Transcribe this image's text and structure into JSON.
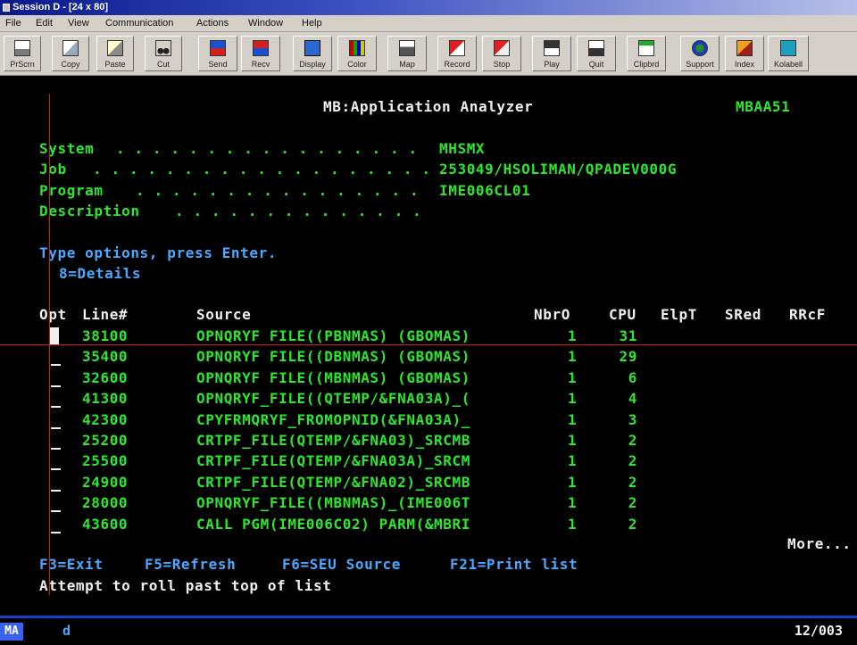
{
  "window": {
    "title": "Session D - [24 x 80]"
  },
  "menu": [
    "File",
    "Edit",
    "View",
    "Communication",
    "Actions",
    "Window",
    "Help"
  ],
  "toolbar": [
    "PrScrn",
    "Copy",
    "Paste",
    "Cut",
    "Send",
    "Recv",
    "Display",
    "Color",
    "Map",
    "Record",
    "Stop",
    "Play",
    "Quit",
    "Clipbrd",
    "Support",
    "Index",
    "Kolabell"
  ],
  "screen": {
    "title": "MB:Application Analyzer",
    "screen_id": "MBAA51",
    "fields": [
      {
        "label": "System",
        "dots": ". . . . . . . . . . . . . . . . .",
        "value": "MHSMX"
      },
      {
        "label": "Job",
        "dots": ". . . . . . . . . . . . . . . . . . .",
        "value": "253049/HSOLIMAN/QPADEV000G"
      },
      {
        "label": "Program",
        "dots": ". . . . . . . . . . . . . . . .",
        "value": "IME006CL01"
      },
      {
        "label": "Description",
        "dots": ". . . . . . . . . . . . . .",
        "value": ""
      }
    ],
    "instructions": "Type options, press Enter.",
    "option_details": "8=Details",
    "columns": {
      "opt": "Opt",
      "line": "Line#",
      "source": "Source",
      "nbro": "NbrO",
      "cpu": "CPU",
      "elpt": "ElpT",
      "sred": "SRed",
      "rrcf": "RRcF"
    },
    "rows": [
      {
        "line": "38100",
        "source": "OPNQRYF FILE((PBNMAS) (GBOMAS)",
        "nbro": "1",
        "cpu": "31"
      },
      {
        "line": "35400",
        "source": "OPNQRYF FILE((DBNMAS) (GBOMAS)",
        "nbro": "1",
        "cpu": "29"
      },
      {
        "line": "32600",
        "source": "OPNQRYF FILE((MBNMAS) (GBOMAS)",
        "nbro": "1",
        "cpu": "6"
      },
      {
        "line": "41300",
        "source": "OPNQRYF_FILE((QTEMP/&FNA03A)_(",
        "nbro": "1",
        "cpu": "4"
      },
      {
        "line": "42300",
        "source": "CPYFRMQRYF_FROMOPNID(&FNA03A)_",
        "nbro": "1",
        "cpu": "3"
      },
      {
        "line": "25200",
        "source": "CRTPF_FILE(QTEMP/&FNA03)_SRCMB",
        "nbro": "1",
        "cpu": "2"
      },
      {
        "line": "25500",
        "source": "CRTPF_FILE(QTEMP/&FNA03A)_SRCM",
        "nbro": "1",
        "cpu": "2"
      },
      {
        "line": "24900",
        "source": "CRTPF_FILE(QTEMP/&FNA02)_SRCMB",
        "nbro": "1",
        "cpu": "2"
      },
      {
        "line": "28000",
        "source": "OPNQRYF_FILE((MBNMAS)_(IME006T",
        "nbro": "1",
        "cpu": "2"
      },
      {
        "line": "43600",
        "source": "CALL PGM(IME006C02) PARM(&MBRI",
        "nbro": "1",
        "cpu": "2"
      }
    ],
    "more": "More...",
    "function_keys": [
      "F3=Exit",
      "F5=Refresh",
      "F6=SEU Source",
      "F21=Print list"
    ],
    "message": "Attempt to roll past top of list"
  },
  "status": {
    "mode": "MA",
    "input": "d",
    "position": "12/003"
  },
  "colors": {
    "green": "#2ee62e",
    "blue": "#4aa8ff",
    "white": "#f0f0f0",
    "red_rule": "#d02020"
  }
}
